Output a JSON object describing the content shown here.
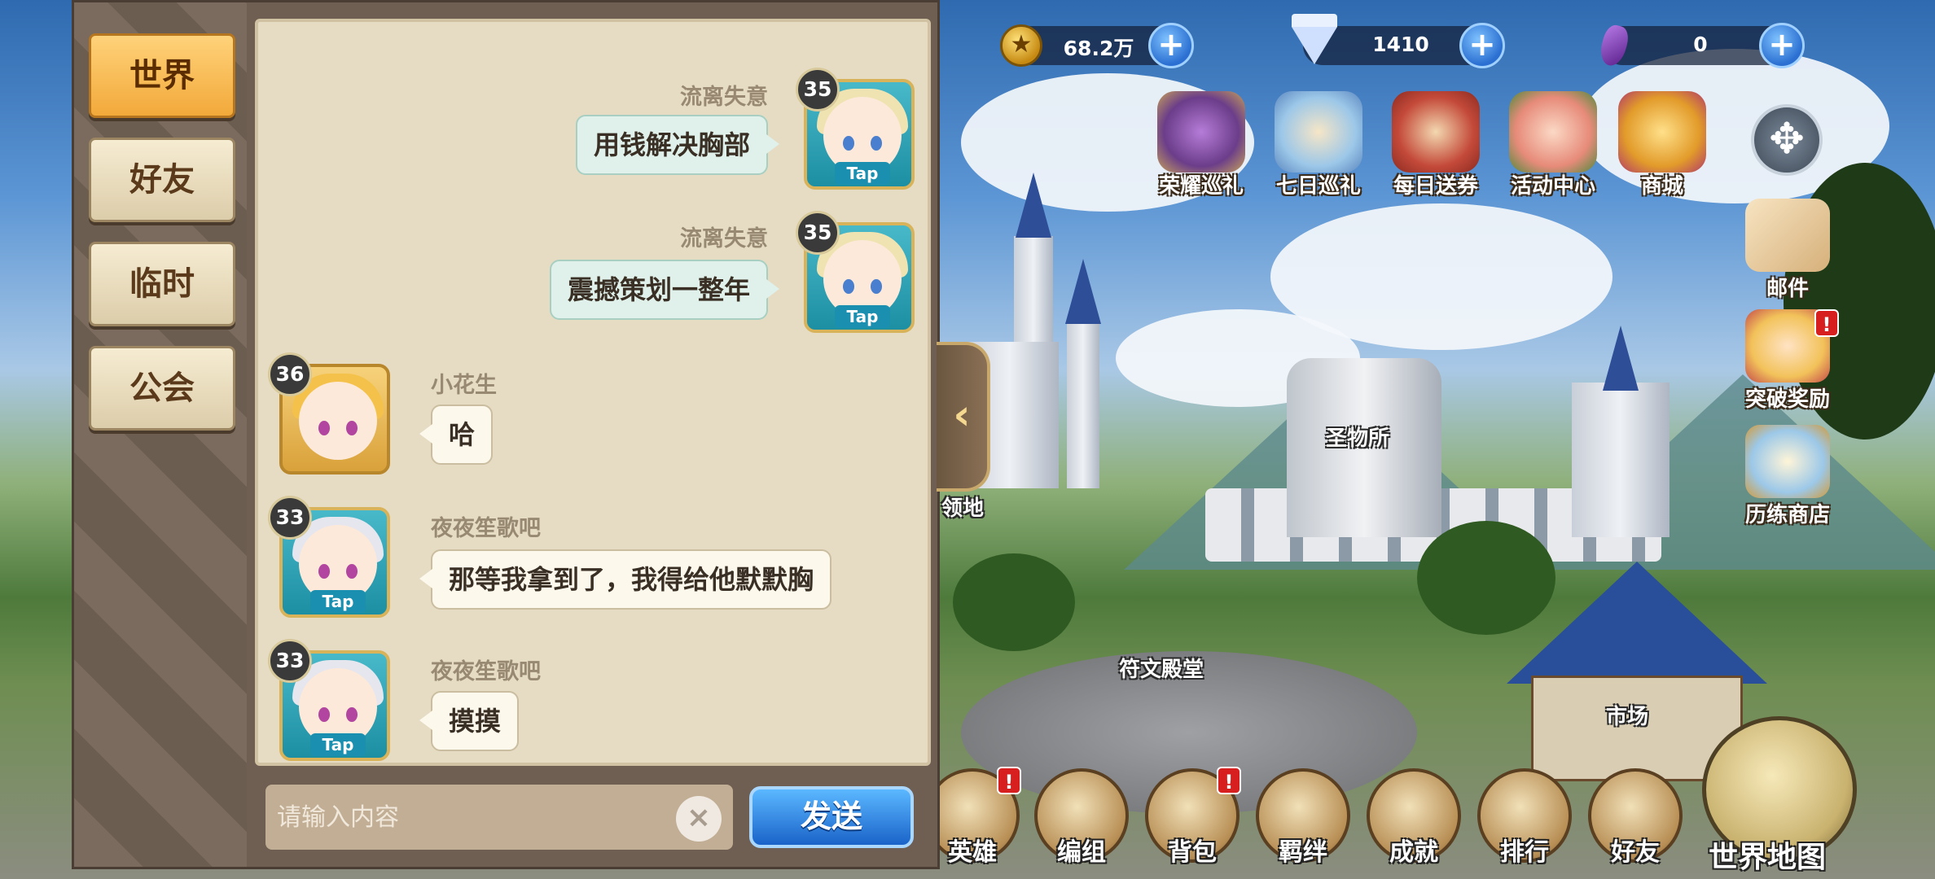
{
  "currencies": [
    {
      "icon": "gold-coin-icon",
      "value": "68.2万"
    },
    {
      "icon": "diamond-icon",
      "value": "1410"
    },
    {
      "icon": "crystal-icon",
      "value": "0"
    }
  ],
  "events": [
    {
      "name": "glory-patrol",
      "label": "荣耀巡礼"
    },
    {
      "name": "seven-day-patrol",
      "label": "七日巡礼"
    },
    {
      "name": "daily-coupon",
      "label": "每日送券"
    },
    {
      "name": "activity-center",
      "label": "活动中心"
    },
    {
      "name": "shop",
      "label": "商城"
    }
  ],
  "side_menu": [
    {
      "name": "mail",
      "label": "邮件"
    },
    {
      "name": "breakthrough-reward",
      "label": "突破奖励"
    },
    {
      "name": "training-shop",
      "label": "历练商店"
    }
  ],
  "places": {
    "holy_relics": "圣物所",
    "rune_hall": "符文殿堂",
    "market": "市场",
    "territory": "领地"
  },
  "bottom_menu": [
    {
      "name": "heroes",
      "label": "英雄",
      "badge": "!"
    },
    {
      "name": "formation",
      "label": "编组",
      "badge": ""
    },
    {
      "name": "backpack",
      "label": "背包",
      "badge": "!"
    },
    {
      "name": "bonds",
      "label": "羁绊",
      "badge": ""
    },
    {
      "name": "achievements",
      "label": "成就",
      "badge": ""
    },
    {
      "name": "ranking",
      "label": "排行",
      "badge": ""
    },
    {
      "name": "friends",
      "label": "好友",
      "badge": ""
    }
  ],
  "world_map_label": "世界地图",
  "chat": {
    "tabs": [
      "世界",
      "好友",
      "临时",
      "公会"
    ],
    "active_tab": "世界",
    "tap_label": "Tap",
    "messages": [
      {
        "side": "right",
        "level": "35",
        "name": "流离失意",
        "text": "用钱解决胸部"
      },
      {
        "side": "right",
        "level": "35",
        "name": "流离失意",
        "text": "震撼策划一整年"
      },
      {
        "side": "left",
        "level": "36",
        "name": "小花生",
        "text": "哈"
      },
      {
        "side": "left",
        "level": "33",
        "name": "夜夜笙歌吧",
        "text": "那等我拿到了，我得给他默默胸"
      },
      {
        "side": "left",
        "level": "33",
        "name": "夜夜笙歌吧",
        "text": "摸摸"
      }
    ],
    "input_placeholder": "请输入内容",
    "send_label": "发送",
    "clear_glyph": "×",
    "collapse_glyph": "‹"
  },
  "colors": {
    "active_tab": "#f2a93a",
    "send_button": "#1a63c9",
    "badge": "#d81f1f"
  }
}
